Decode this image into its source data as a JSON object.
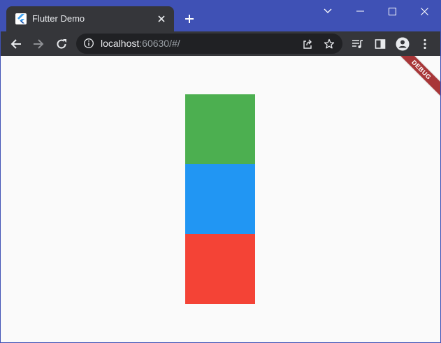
{
  "window": {
    "frame_color": "#3f51b5"
  },
  "tab": {
    "title": "Flutter Demo",
    "favicon": "flutter-icon"
  },
  "toolbar": {
    "url_host": "localhost",
    "url_rest": ":60630/#/"
  },
  "content": {
    "background": "#fafafa",
    "boxes": [
      {
        "name": "green-box",
        "color": "#4caf50"
      },
      {
        "name": "blue-box",
        "color": "#2196f3"
      },
      {
        "name": "red-box",
        "color": "#f44336"
      }
    ],
    "debug_banner": "DEBUG"
  }
}
